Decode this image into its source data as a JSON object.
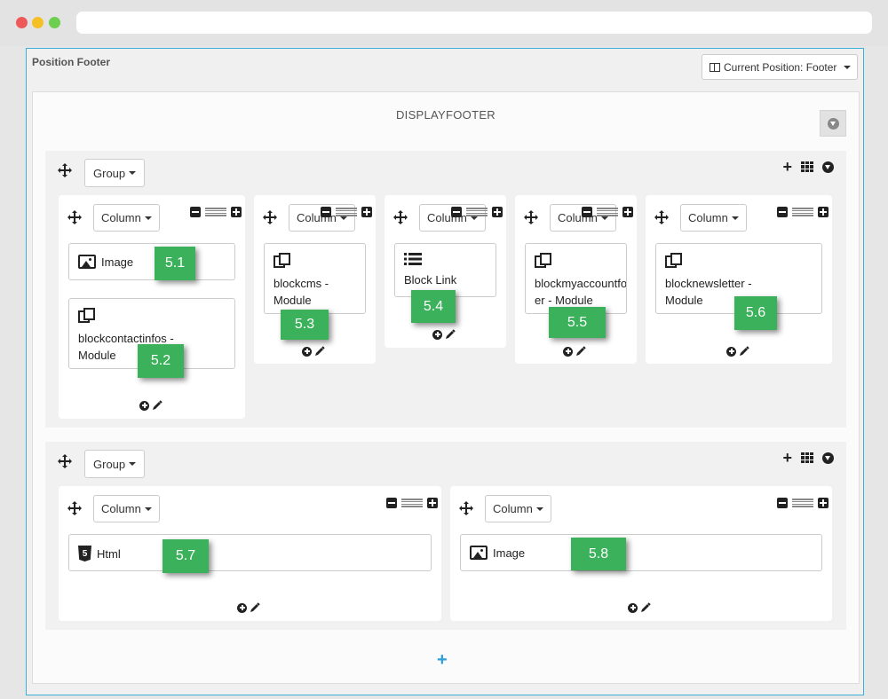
{
  "page": {
    "title": "Position Footer",
    "position_button": "Current Position: Footer",
    "hook_title": "DISPLAYFOOTER",
    "add_group_symbol": "+"
  },
  "labels": {
    "group": "Group",
    "column": "Column"
  },
  "groups": [
    {
      "columns": [
        {
          "modules": [
            {
              "label": "Image",
              "icon": "image-icon",
              "badge": "5.1"
            },
            {
              "label": "blockcontactinfos - Module",
              "icon": "module-icon",
              "badge": "5.2"
            }
          ]
        },
        {
          "modules": [
            {
              "label": "blockcms - Module",
              "icon": "module-icon",
              "badge": "5.3"
            }
          ]
        },
        {
          "modules": [
            {
              "label": "Block Link",
              "icon": "list-icon",
              "badge": "5.4"
            }
          ]
        },
        {
          "modules": [
            {
              "label": "blockmyaccountfooter - Module",
              "icon": "module-icon",
              "badge": "5.5"
            }
          ]
        },
        {
          "modules": [
            {
              "label": "blocknewsletter - Module",
              "icon": "module-icon",
              "badge": "5.6"
            }
          ]
        }
      ]
    },
    {
      "columns": [
        {
          "modules": [
            {
              "label": "Html",
              "icon": "html5-icon",
              "badge": "5.7"
            }
          ]
        },
        {
          "modules": [
            {
              "label": "Image",
              "icon": "image-icon",
              "badge": "5.8"
            }
          ]
        }
      ]
    }
  ],
  "colors": {
    "frame_border": "#3ab0d8",
    "badge": "#3ab15a",
    "add_icon": "#2a9fd8"
  }
}
